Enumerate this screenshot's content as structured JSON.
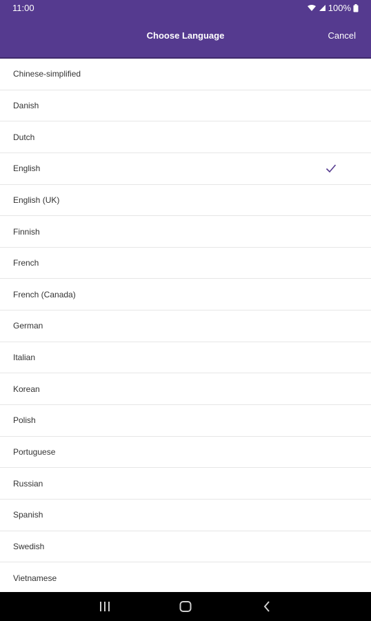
{
  "status": {
    "time": "11:00",
    "battery": "100%"
  },
  "header": {
    "title": "Choose Language",
    "cancel_label": "Cancel"
  },
  "languages": [
    {
      "label": "Chinese-simplified",
      "selected": false
    },
    {
      "label": "Danish",
      "selected": false
    },
    {
      "label": "Dutch",
      "selected": false
    },
    {
      "label": "English",
      "selected": true
    },
    {
      "label": "English (UK)",
      "selected": false
    },
    {
      "label": "Finnish",
      "selected": false
    },
    {
      "label": "French",
      "selected": false
    },
    {
      "label": "French (Canada)",
      "selected": false
    },
    {
      "label": "German",
      "selected": false
    },
    {
      "label": "Italian",
      "selected": false
    },
    {
      "label": "Korean",
      "selected": false
    },
    {
      "label": "Polish",
      "selected": false
    },
    {
      "label": "Portuguese",
      "selected": false
    },
    {
      "label": "Russian",
      "selected": false
    },
    {
      "label": "Spanish",
      "selected": false
    },
    {
      "label": "Swedish",
      "selected": false
    },
    {
      "label": "Vietnamese",
      "selected": false
    }
  ],
  "icons": {
    "selected": "checkmark-icon",
    "nav": [
      "recent-apps-icon",
      "home-icon",
      "back-icon"
    ]
  },
  "colors": {
    "header": "#553a8f",
    "check": "#553a8f"
  }
}
